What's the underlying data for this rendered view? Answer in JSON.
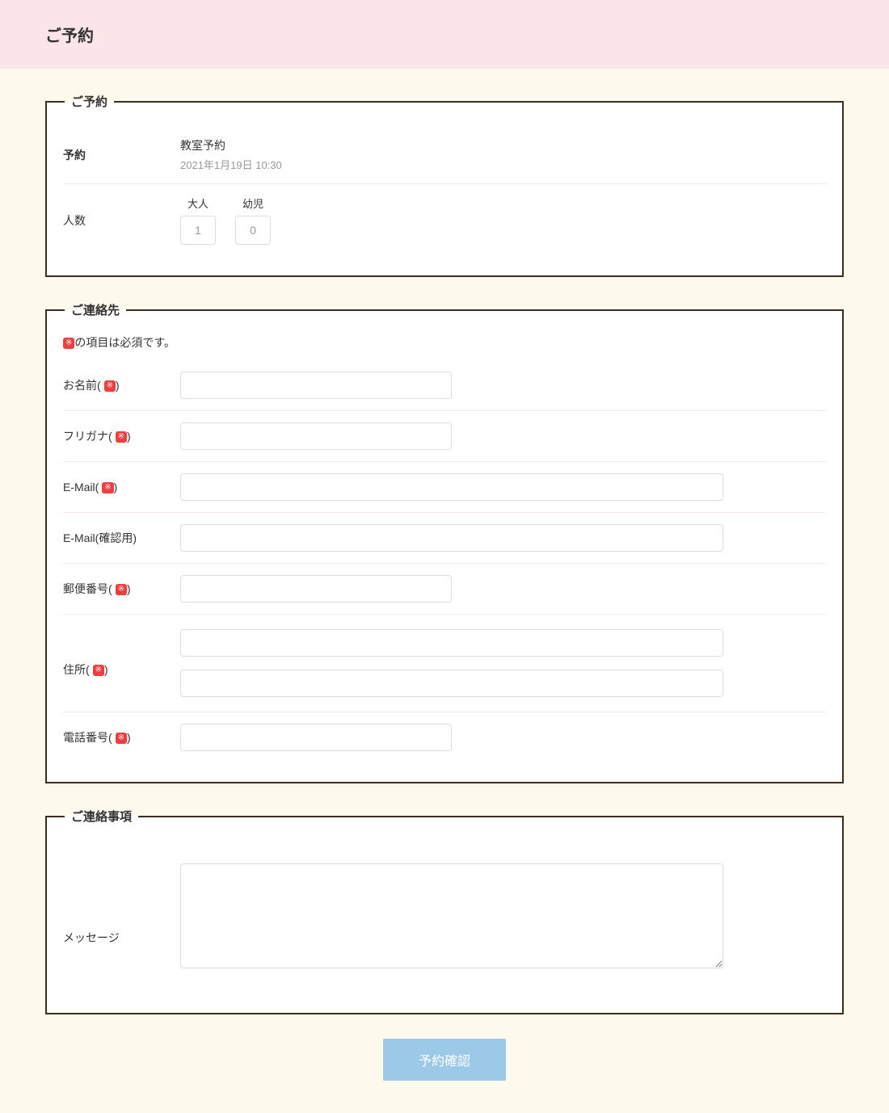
{
  "header": {
    "title": "ご予約"
  },
  "reservation": {
    "legend": "ご予約",
    "booking_label": "予約",
    "booking_type": "教室予約",
    "booking_date": "2021年1月19日 10:30",
    "count_label": "人数",
    "adult_label": "大人",
    "adult_value": "1",
    "child_label": "幼児",
    "child_value": "0"
  },
  "contact": {
    "legend": "ご連絡先",
    "required_note_prefix": "",
    "required_note_suffix": "の項目は必須です。",
    "required_mark": "※",
    "fields": {
      "name_label": "お名前( ",
      "name_suffix": ")",
      "furigana_label": "フリガナ( ",
      "furigana_suffix": ")",
      "email_label": "E-Mail( ",
      "email_suffix": ")",
      "email_confirm_label": "E-Mail(確認用)",
      "postal_label": "郵便番号( ",
      "postal_suffix": ")",
      "address_label": "住所( ",
      "address_suffix": ")",
      "phone_label": "電話番号( ",
      "phone_suffix": ")"
    }
  },
  "message_section": {
    "legend": "ご連絡事項",
    "message_label": "メッセージ"
  },
  "submit": {
    "label": "予約確認"
  }
}
